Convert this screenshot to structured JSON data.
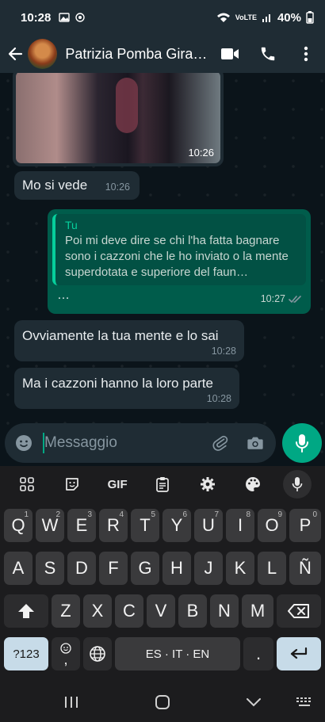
{
  "status_bar": {
    "time": "10:28",
    "battery": "40%",
    "network": "VoLTE"
  },
  "header": {
    "contact_name": "Patrizia Pomba Gira…",
    "icons": [
      "back-arrow-icon",
      "video-call-icon",
      "phone-icon",
      "more-vert-icon"
    ]
  },
  "messages": [
    {
      "type": "image",
      "direction": "in",
      "time": "10:26"
    },
    {
      "type": "text",
      "direction": "in",
      "text": "Mo si vede",
      "time": "10:26"
    },
    {
      "type": "reply",
      "direction": "out",
      "quoted_name": "Tu",
      "quoted_text": "Poi mi deve dire se chi l'ha fatta bagnare sono i cazzoni che le ho inviato o la mente superdotata e superiore del faun…",
      "body": "…",
      "time": "10:27",
      "status": "read"
    },
    {
      "type": "text",
      "direction": "in",
      "text": "Ovviamente la tua mente e lo sai",
      "time": "10:28"
    },
    {
      "type": "text",
      "direction": "in",
      "text": "Ma i cazzoni hanno la loro parte",
      "time": "10:28"
    }
  ],
  "composer": {
    "placeholder": "Messaggio",
    "icons": [
      "emoji-icon",
      "attach-icon",
      "camera-icon",
      "mic-icon"
    ]
  },
  "keyboard": {
    "toolbar": [
      "apps-grid-icon",
      "sticker-icon",
      "GIF",
      "clipboard-icon",
      "settings-icon",
      "palette-icon",
      "mic-icon"
    ],
    "row1": [
      {
        "k": "Q",
        "s": "1"
      },
      {
        "k": "W",
        "s": "2"
      },
      {
        "k": "E",
        "s": "3"
      },
      {
        "k": "R",
        "s": "4"
      },
      {
        "k": "T",
        "s": "5"
      },
      {
        "k": "Y",
        "s": "6"
      },
      {
        "k": "U",
        "s": "7"
      },
      {
        "k": "I",
        "s": "8"
      },
      {
        "k": "O",
        "s": "9"
      },
      {
        "k": "P",
        "s": "0"
      }
    ],
    "row2": [
      "A",
      "S",
      "D",
      "F",
      "G",
      "H",
      "J",
      "K",
      "L",
      "Ñ"
    ],
    "row3": [
      "Z",
      "X",
      "C",
      "V",
      "B",
      "N",
      "M"
    ],
    "sym_key": "?123",
    "emoji_comma": ",",
    "space_label": "ES · IT · EN",
    "period": "."
  },
  "colors": {
    "accent": "#00a884",
    "outgoing_bubble": "#005c4b",
    "incoming_bubble": "#1f2c34",
    "chat_bg": "#0b141a"
  }
}
